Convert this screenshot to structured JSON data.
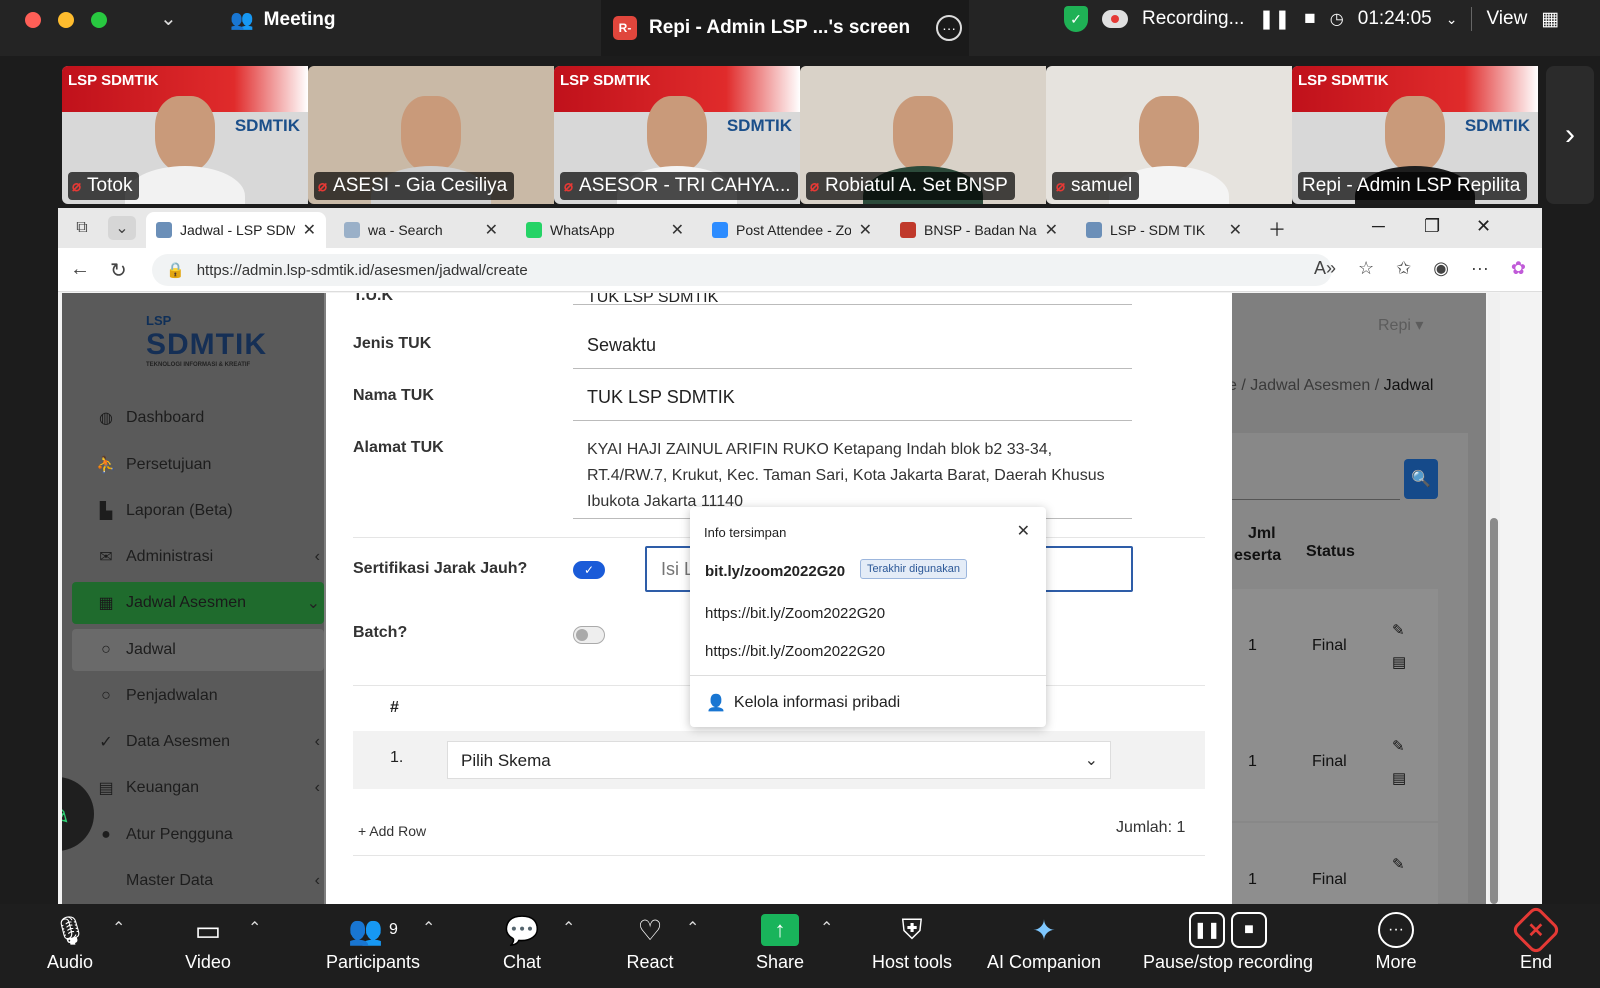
{
  "meeting": {
    "title": "Meeting",
    "share_badge": "R-",
    "share_title": "Repi - Admin LSP ...'s screen",
    "recording_label": "Recording...",
    "timer": "01:24:05",
    "view_label": "View"
  },
  "participants": [
    {
      "name": "Totok",
      "muted": true,
      "branded": true
    },
    {
      "name": "ASESI - Gia Cesiliya",
      "muted": true,
      "branded": false
    },
    {
      "name": "ASESOR - TRI CAHYA...",
      "muted": true,
      "branded": true
    },
    {
      "name": "Robiatul A. Set BNSP",
      "muted": true,
      "branded": false
    },
    {
      "name": "samuel",
      "muted": true,
      "branded": false
    },
    {
      "name": "Repi - Admin LSP Repilita",
      "muted": false,
      "branded": true
    }
  ],
  "thumb_brand": "LSP SDMTIK",
  "thumb_brand2": "SDMTIK",
  "browser": {
    "tabs": [
      {
        "label": "Jadwal - LSP SDMTIK",
        "active": true,
        "color": "#6b8fb8"
      },
      {
        "label": "wa - Search",
        "active": false,
        "color": "#9ab0c8"
      },
      {
        "label": "WhatsApp",
        "active": false,
        "color": "#25d366"
      },
      {
        "label": "Post Attendee - Zoom",
        "active": false,
        "color": "#2d8cff"
      },
      {
        "label": "BNSP - Badan Nasional",
        "active": false,
        "color": "#c0392b"
      },
      {
        "label": "LSP - SDM TIK",
        "active": false,
        "color": "#6b8fb8"
      }
    ],
    "url": "https://admin.lsp-sdmtik.id/asesmen/jadwal/create"
  },
  "sidebar": {
    "logo_top": "LSP",
    "logo_main": "SDMTIK",
    "logo_sub": "TEKNOLOGI INFORMASI & KREATIF",
    "items": [
      {
        "label": "Dashboard",
        "icon": "◍",
        "chev": false
      },
      {
        "label": "Persetujuan",
        "icon": "⛹",
        "chev": false
      },
      {
        "label": "Laporan (Beta)",
        "icon": "▙",
        "chev": false
      },
      {
        "label": "Administrasi",
        "icon": "✉",
        "chev": true
      },
      {
        "label": "Jadwal Asesmen",
        "icon": "▦",
        "chev": true
      },
      {
        "label": "Jadwal",
        "icon": "○",
        "chev": false
      },
      {
        "label": "Penjadwalan",
        "icon": "○",
        "chev": false
      },
      {
        "label": "Data Asesmen",
        "icon": "✓",
        "chev": true
      },
      {
        "label": "Keuangan",
        "icon": "▤",
        "chev": true
      },
      {
        "label": "Atur Pengguna",
        "icon": "●",
        "chev": false
      },
      {
        "label": "Master Data",
        "icon": "",
        "chev": true
      }
    ]
  },
  "right_pane": {
    "user": "Repi ▾",
    "breadcrumb_part": "e / Jadwal Asesmen / ",
    "breadcrumb_current": "Jadwal",
    "col_jml_1": "Jml",
    "col_jml_2": "eserta",
    "col_status": "Status",
    "rows": [
      {
        "count": "1",
        "status": "Final"
      },
      {
        "count": "1",
        "status": "Final"
      },
      {
        "count": "1",
        "status": "Final"
      }
    ]
  },
  "form": {
    "tuk_label": "T.U.K",
    "tuk_value": "TUK LSP SDMTIK",
    "jenis_label": "Jenis TUK",
    "jenis_value": "Sewaktu",
    "nama_label": "Nama TUK",
    "nama_value": "TUK LSP SDMTIK",
    "alamat_label": "Alamat TUK",
    "alamat_value": "KYAI HAJI ZAINUL ARIFIN RUKO Ketapang Indah blok b2 33-34, RT.4/RW.7, Krukut, Kec. Taman Sari, Kota Jakarta Barat, Daerah Khusus Ibukota Jakarta 11140",
    "sjj_label": "Sertifikasi Jarak Jauh?",
    "sjj_placeholder": "Isi Link SJJ di sini",
    "batch_label": "Batch?",
    "hash": "#",
    "row_num": "1.",
    "skema_value": "Pilih Skema",
    "add_row": "+ Add Row",
    "jumlah": "Jumlah: 1"
  },
  "autofill": {
    "title": "Info tersimpan",
    "items": [
      "bit.ly/zoom2022G20",
      "https://bit.ly/Zoom2022G20",
      "https://bit.ly/Zoom2022G20"
    ],
    "badge": "Terakhir digunakan",
    "manage": "Kelola informasi pribadi"
  },
  "toolbar": {
    "audio": "Audio",
    "video": "Video",
    "participants": "Participants",
    "participants_count": "9",
    "chat": "Chat",
    "react": "React",
    "share": "Share",
    "host_tools": "Host tools",
    "ai": "AI Companion",
    "pause": "Pause/stop recording",
    "more": "More",
    "end": "End"
  }
}
